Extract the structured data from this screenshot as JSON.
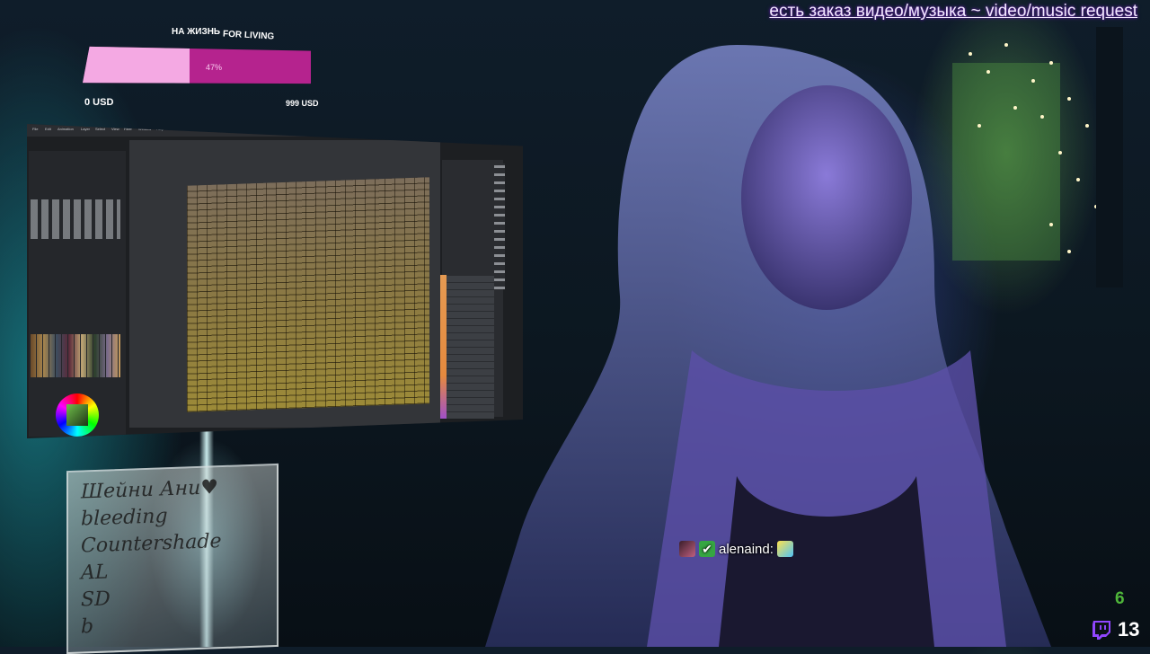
{
  "banner": {
    "request_text": "есть заказ видео/музыка ~ video/music request"
  },
  "donation_goal": {
    "label_ru": "НА ЖИЗНЬ",
    "label_en": "FOR LIVING",
    "start_amount": "0 USD",
    "target_amount": "999 USD",
    "percent_label": "47%",
    "progress_fraction": 0.47
  },
  "drawing_app": {
    "menu": [
      "File",
      "Edit",
      "Animation",
      "Layer",
      "Select",
      "View",
      "Filter",
      "Window",
      "Help"
    ]
  },
  "sign": {
    "text": "Шейни Ани♥\nbleeding\nCountershade\nAL\nSD\nb"
  },
  "chat": {
    "username": "alenaind:"
  },
  "viewers": {
    "green_count": "6",
    "twitch_count": "13"
  },
  "colors": {
    "goal_fill": "#f4a9e3",
    "goal_track": "#b5238e",
    "twitch_purple": "#9146ff",
    "viewer_green": "#4fb63a"
  }
}
